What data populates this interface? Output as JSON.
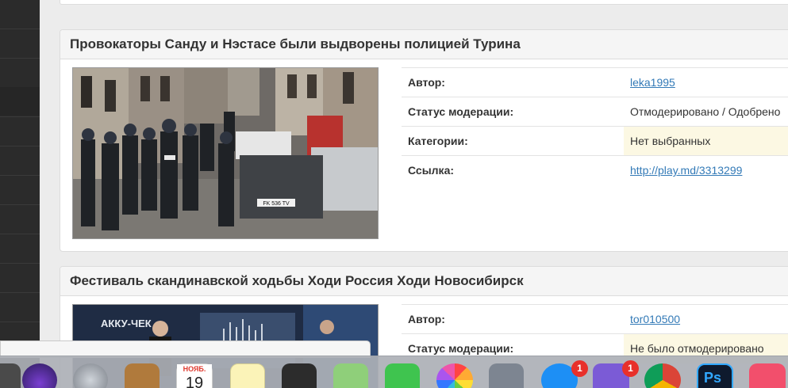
{
  "posts": [
    {
      "title": "Провокаторы Санду и Нэстасе были выдворены полицией Турина",
      "rows": [
        {
          "label": "Автор:",
          "value": "leka1995",
          "link": true,
          "highlight": false
        },
        {
          "label": "Статус модерации:",
          "value": "Отмодерировано / Одобрено",
          "link": false,
          "highlight": false
        },
        {
          "label": "Категории:",
          "value": "Нет выбранных",
          "link": false,
          "highlight": true
        },
        {
          "label": "Ссылка:",
          "value": "http://play.md/3313299",
          "link": true,
          "highlight": false
        }
      ],
      "plate_text": "FK 536 TV"
    },
    {
      "title": "Фестиваль скандинавской ходьбы Ходи Россия Ходи Новосибирск",
      "rows": [
        {
          "label": "Автор:",
          "value": "tor010500",
          "link": true,
          "highlight": false
        },
        {
          "label": "Статус модерации:",
          "value": "Не было отмодерировано",
          "link": false,
          "highlight": true
        }
      ],
      "banner_text": "АККУ-ЧЕК"
    }
  ],
  "dock": {
    "calendar_month": "НОЯБ.",
    "calendar_day": "19",
    "app_store_badge": "1",
    "viber_badge": "1",
    "photoshop_label": "Ps"
  }
}
